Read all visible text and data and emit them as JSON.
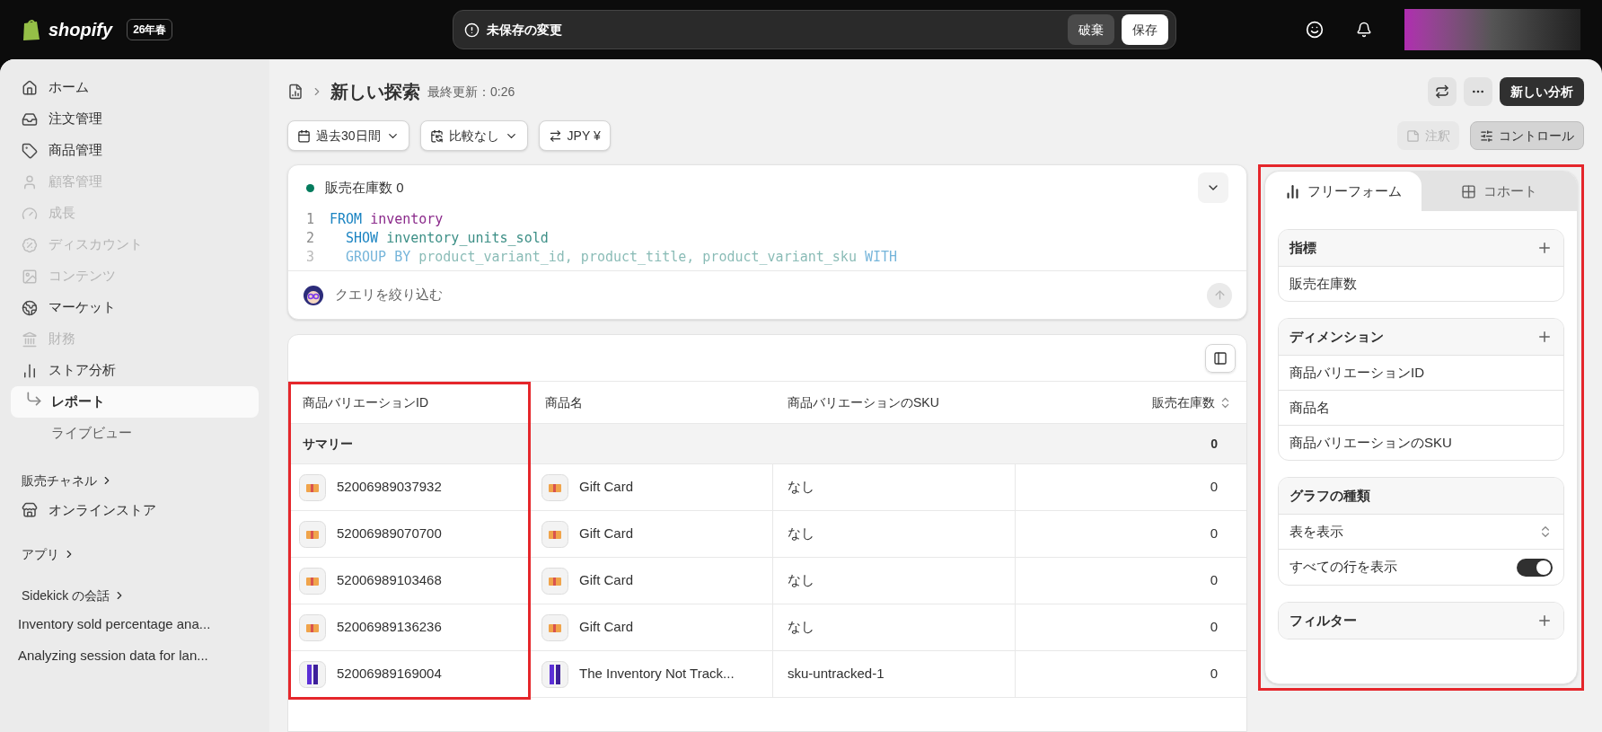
{
  "topbar": {
    "logo": "shopify",
    "edition_badge": "26年春",
    "unsaved": {
      "message": "未保存の変更",
      "discard": "破棄",
      "save": "保存"
    }
  },
  "sidebar": {
    "items": [
      {
        "label": "ホーム",
        "disabled": false,
        "selected": false
      },
      {
        "label": "注文管理",
        "disabled": false,
        "selected": false
      },
      {
        "label": "商品管理",
        "disabled": false,
        "selected": false
      },
      {
        "label": "顧客管理",
        "disabled": true,
        "selected": false
      },
      {
        "label": "成長",
        "disabled": true,
        "selected": false
      },
      {
        "label": "ディスカウント",
        "disabled": true,
        "selected": false
      },
      {
        "label": "コンテンツ",
        "disabled": true,
        "selected": false
      },
      {
        "label": "マーケット",
        "disabled": false,
        "selected": false
      },
      {
        "label": "財務",
        "disabled": true,
        "selected": false
      },
      {
        "label": "ストア分析",
        "disabled": false,
        "selected": false,
        "children": [
          {
            "label": "レポート",
            "selected": true
          },
          {
            "label": "ライブビュー",
            "selected": false
          }
        ]
      }
    ],
    "sales_channels": {
      "heading": "販売チャネル",
      "items": [
        {
          "label": "オンラインストア"
        }
      ]
    },
    "apps": {
      "heading": "アプリ"
    },
    "sidekick": {
      "heading": "Sidekick の会話",
      "items": [
        "Inventory sold percentage ana...",
        "Analyzing session data for lan..."
      ]
    }
  },
  "header": {
    "title": "新しい探索",
    "last_updated": "最終更新：0:26",
    "new_analysis": "新しい分析"
  },
  "filters": [
    {
      "kind": "date",
      "label": "過去30日間"
    },
    {
      "kind": "compare",
      "label": "比較なし"
    },
    {
      "kind": "currency",
      "label": "JPY ¥"
    }
  ],
  "actions": {
    "annotate": {
      "label": "注釈",
      "disabled": true
    },
    "controls": {
      "label": "コントロール",
      "selected": true
    }
  },
  "query": {
    "title": "販売在庫数 0",
    "lines": [
      {
        "number": "1",
        "faded": false,
        "tokens": [
          {
            "text": "FROM",
            "kind": "keyword"
          },
          {
            "text": "inventory",
            "kind": "source"
          }
        ]
      },
      {
        "number": "2",
        "faded": false,
        "tokens": [
          {
            "text": "SHOW",
            "kind": "keyword"
          },
          {
            "text": "inventory_units_sold",
            "kind": "field"
          }
        ]
      },
      {
        "number": "3",
        "faded": true,
        "tokens": [
          {
            "text": "GROUP BY",
            "kind": "keyword"
          },
          {
            "text": "product_variant_id, product_title, product_variant_sku",
            "kind": "field"
          },
          {
            "text": "WITH",
            "kind": "keyword"
          }
        ]
      }
    ],
    "refine_placeholder": "クエリを絞り込む"
  },
  "table": {
    "columns": [
      "商品バリエーションID",
      "商品名",
      "商品バリエーションのSKU",
      "販売在庫数"
    ],
    "summary": {
      "label": "サマリー",
      "value": "0"
    },
    "rows": [
      {
        "kind": "gift",
        "variant_id": "52006989037932",
        "product": "Gift Card",
        "sku": "なし",
        "sold": "0"
      },
      {
        "kind": "gift",
        "variant_id": "52006989070700",
        "product": "Gift Card",
        "sku": "なし",
        "sold": "0"
      },
      {
        "kind": "gift",
        "variant_id": "52006989103468",
        "product": "Gift Card",
        "sku": "なし",
        "sold": "0"
      },
      {
        "kind": "gift",
        "variant_id": "52006989136236",
        "product": "Gift Card",
        "sku": "なし",
        "sold": "0"
      },
      {
        "kind": "bars",
        "variant_id": "52006989169004",
        "product": "The Inventory Not Track...",
        "sku": "sku-untracked-1",
        "sold": "0"
      }
    ]
  },
  "panel": {
    "tabs": [
      {
        "label": "フリーフォーム",
        "selected": true
      },
      {
        "label": "コホート",
        "selected": false
      }
    ],
    "metrics": {
      "heading": "指標",
      "items": [
        "販売在庫数"
      ]
    },
    "dimensions": {
      "heading": "ディメンション",
      "items": [
        "商品バリエーションID",
        "商品名",
        "商品バリエーションのSKU"
      ]
    },
    "chart_type": {
      "heading": "グラフの種類",
      "select": "表を表示",
      "show_all_rows": {
        "label": "すべての行を表示",
        "on": true
      }
    },
    "filters": {
      "heading": "フィルター"
    }
  }
}
